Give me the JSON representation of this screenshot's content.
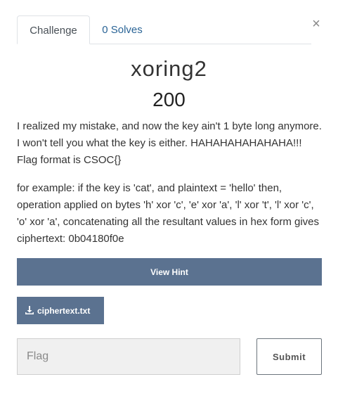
{
  "tabs": {
    "challenge_label": "Challenge",
    "solves_label": "0 Solves"
  },
  "close_symbol": "×",
  "challenge": {
    "name": "xoring2",
    "points": "200",
    "description_paragraphs": [
      "I realized my mistake, and now the key ain't 1 byte long anymore. I won't tell you what the key is either. HAHAHAHAHAHAHA!!! Flag format is CSOC{}",
      "for example: if the key is 'cat', and plaintext = 'hello' then, operation applied on bytes 'h' xor 'c', 'e' xor 'a', 'l' xor 't', 'l' xor 'c', 'o' xor 'a', concatenating all the resultant values in hex form gives ciphertext: 0b04180f0e"
    ]
  },
  "hint_button_label": "View Hint",
  "file": {
    "icon": "download-icon",
    "name": "ciphertext.txt"
  },
  "flag_input": {
    "placeholder": "Flag",
    "value": ""
  },
  "submit_label": "Submit",
  "colors": {
    "button_bg": "#5b7290",
    "link": "#2a6496"
  }
}
